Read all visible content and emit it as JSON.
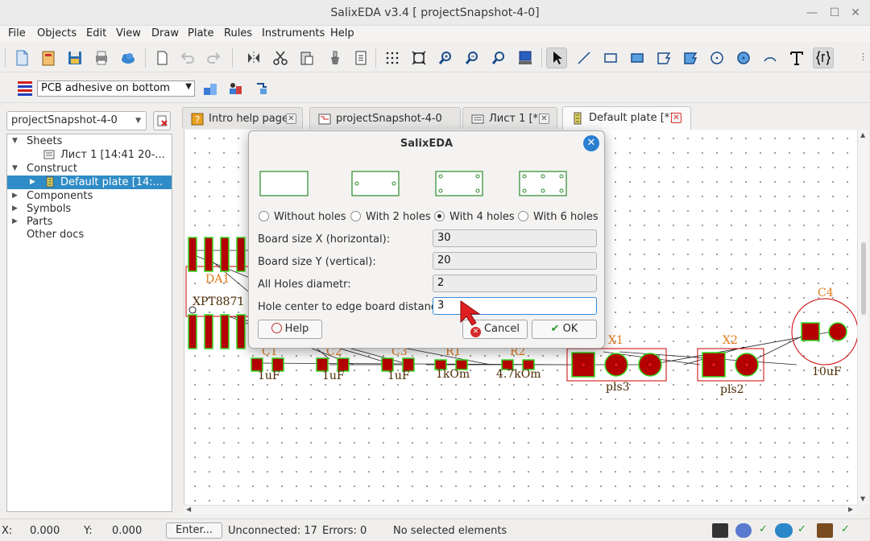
{
  "window": {
    "title": "SalixEDA v3.4 [ projectSnapshot-4-0]"
  },
  "menu": [
    "File",
    "Objects",
    "Edit",
    "View",
    "Draw",
    "Plate",
    "Rules",
    "Instruments",
    "Help"
  ],
  "toolbar2": {
    "layer_value": "PCB adhesive on bottom"
  },
  "project": {
    "selector_value": "projectSnapshot-4-0",
    "tree": {
      "sheets": "Sheets",
      "sheet_item": "Лист 1 [14:41 20-...",
      "construct": "Construct",
      "plate_item": "Default plate [14:...",
      "components": "Components",
      "symbols": "Symbols",
      "parts": "Parts",
      "other": "Other docs"
    }
  },
  "tabs": [
    "Intro help page",
    "projectSnapshot-4-0",
    "Лист 1 [*]",
    "Default plate [*]"
  ],
  "board": {
    "labels": {
      "da1": "DA1",
      "xpt": "XPT8871",
      "c1": "C1",
      "c2": "C2",
      "c3": "C3",
      "r1": "R1",
      "r2": "R2",
      "x1": "X1",
      "x2": "X2",
      "c4": "C4",
      "val_c1": "1uF",
      "val_c2": "1uF",
      "val_c3": "1uF",
      "val_r1": "1kOm",
      "val_r2": "4.7kOm",
      "pls3": "pls3",
      "pls2": "pls2",
      "val_c4": "10uF"
    }
  },
  "dialog": {
    "title": "SalixEDA",
    "options": [
      "Without holes",
      "With 2 holes",
      "With 4 holes",
      "With 6 holes"
    ],
    "selected_option": "With 4 holes",
    "fields": {
      "size_x_label": "Board size X (horizontal):",
      "size_x_value": "30",
      "size_y_label": "Board size Y (vertical):",
      "size_y_value": "20",
      "diam_label": "All Holes diametr:",
      "diam_value": "2",
      "edge_label": "Hole center to edge board distance:",
      "edge_value": "3"
    },
    "help_label": "Help",
    "cancel_label": "Cancel",
    "ok_label": "OK"
  },
  "status": {
    "x_label": "X:",
    "x_value": "0.000",
    "y_label": "Y:",
    "y_value": "0.000",
    "enter_label": "Enter...",
    "unconnected": "Unconnected: 17",
    "errors": "Errors: 0",
    "selection": "No selected elements"
  },
  "colors": {
    "accent": "#308cc6",
    "pad": "#b40000",
    "pad_outline": "#33dd22",
    "silk": "#e07a1a",
    "outline": "#cc0000"
  }
}
